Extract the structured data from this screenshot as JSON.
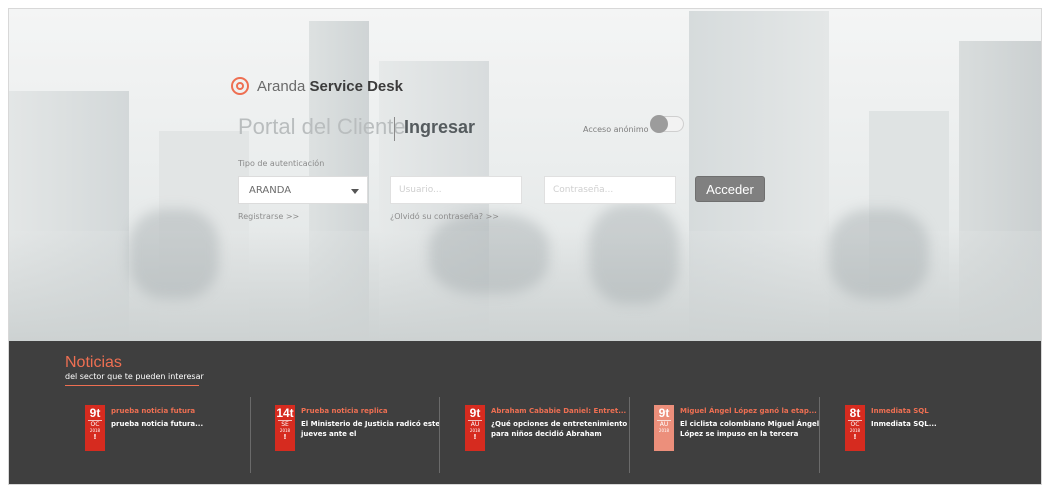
{
  "brand": {
    "prefix": "Aranda",
    "name": "Service Desk"
  },
  "header": {
    "portal_title": "Portal del Cliente",
    "action": "Ingresar"
  },
  "anonymous": {
    "label": "Acceso anónimo",
    "enabled": false
  },
  "login": {
    "auth_label": "Tipo de autenticación",
    "auth_value": "ARANDA",
    "user_placeholder": "Usuario...",
    "password_placeholder": "Contraseña...",
    "submit_label": "Acceder",
    "register_link": "Registrarse >>",
    "forgot_link": "¿Olvidó su contraseña? >>"
  },
  "news": {
    "title": "Noticias",
    "subtitle": "del sector que te pueden interesar",
    "items": [
      {
        "day": "9t",
        "month": "OC",
        "year": "2018",
        "title": "prueba noticia futura",
        "text": "prueba noticia futura...",
        "badge_color": "#d62b1f"
      },
      {
        "day": "14t",
        "month": "SE",
        "year": "2018",
        "title": "Prueba noticia replica",
        "text": "El Ministerio de Justicia radicó este jueves ante el",
        "badge_color": "#d62b1f"
      },
      {
        "day": "9t",
        "month": "AU",
        "year": "2018",
        "title": "Abraham Cababie Daniel: Entret...",
        "text": "¿Qué opciones de entretenimiento para niños decidió Abraham",
        "badge_color": "#d62b1f"
      },
      {
        "day": "9t",
        "month": "AU",
        "year": "2018",
        "title": "Miguel Ángel López ganó la etap...",
        "text": "El ciclista colombiano Miguel Ángel López se impuso en la tercera",
        "badge_color": "#ec8f7b"
      },
      {
        "day": "8t",
        "month": "OC",
        "year": "2018",
        "title": "Inmediata SQL",
        "text": "Inmediata SQL...",
        "badge_color": "#d62b1f"
      }
    ]
  },
  "colors": {
    "accent": "#ee6f52",
    "news_bg": "#3f3f3f",
    "badge": "#d62b1f",
    "button": "#808080"
  }
}
